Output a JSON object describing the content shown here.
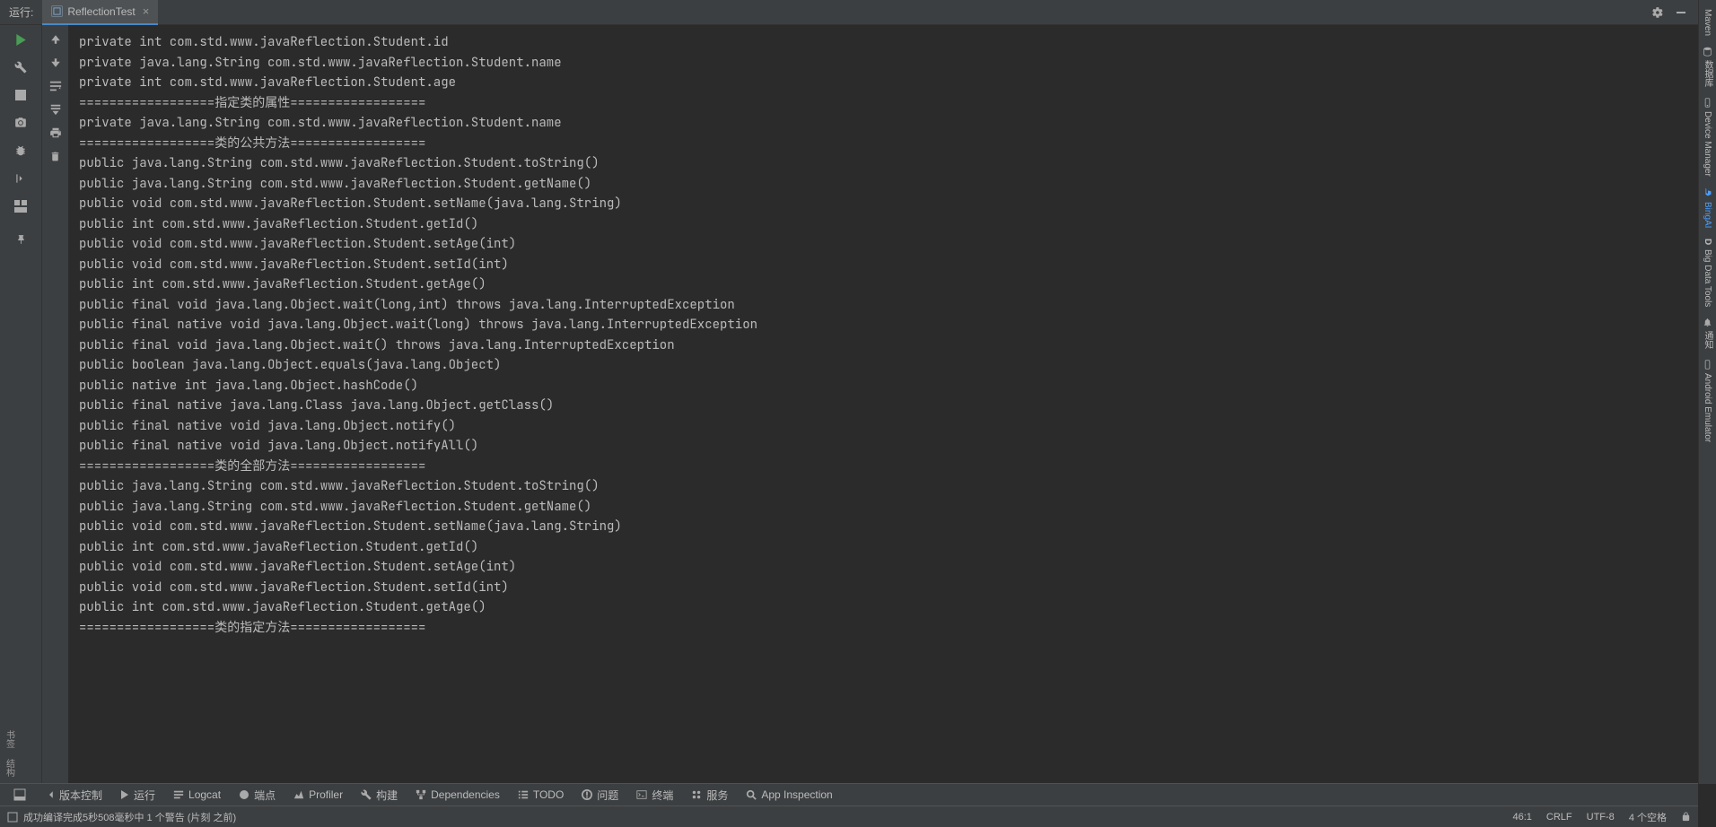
{
  "tabbar": {
    "run_label": "运行:",
    "tab_name": "ReflectionTest",
    "close_glyph": "×"
  },
  "console": {
    "lines": [
      "private int com.std.www.javaReflection.Student.id",
      "private java.lang.String com.std.www.javaReflection.Student.name",
      "private int com.std.www.javaReflection.Student.age",
      "==================指定类的属性==================",
      "private java.lang.String com.std.www.javaReflection.Student.name",
      "==================类的公共方法==================",
      "public java.lang.String com.std.www.javaReflection.Student.toString()",
      "public java.lang.String com.std.www.javaReflection.Student.getName()",
      "public void com.std.www.javaReflection.Student.setName(java.lang.String)",
      "public int com.std.www.javaReflection.Student.getId()",
      "public void com.std.www.javaReflection.Student.setAge(int)",
      "public void com.std.www.javaReflection.Student.setId(int)",
      "public int com.std.www.javaReflection.Student.getAge()",
      "public final void java.lang.Object.wait(long,int) throws java.lang.InterruptedException",
      "public final native void java.lang.Object.wait(long) throws java.lang.InterruptedException",
      "public final void java.lang.Object.wait() throws java.lang.InterruptedException",
      "public boolean java.lang.Object.equals(java.lang.Object)",
      "public native int java.lang.Object.hashCode()",
      "public final native java.lang.Class java.lang.Object.getClass()",
      "public final native void java.lang.Object.notify()",
      "public final native void java.lang.Object.notifyAll()",
      "==================类的全部方法==================",
      "public java.lang.String com.std.www.javaReflection.Student.toString()",
      "public java.lang.String com.std.www.javaReflection.Student.getName()",
      "public void com.std.www.javaReflection.Student.setName(java.lang.String)",
      "public int com.std.www.javaReflection.Student.getId()",
      "public void com.std.www.javaReflection.Student.setAge(int)",
      "public void com.std.www.javaReflection.Student.setId(int)",
      "public int com.std.www.javaReflection.Student.getAge()",
      "==================类的指定方法=================="
    ]
  },
  "bottom_tools": {
    "version_control": "版本控制",
    "run": "运行",
    "logcat": "Logcat",
    "terminal": "端点",
    "profiler": "Profiler",
    "build": "构建",
    "dependencies": "Dependencies",
    "todo": "TODO",
    "problems": "问题",
    "terminal2": "终端",
    "services": "服务",
    "app_inspection": "App Inspection"
  },
  "status": {
    "message": "成功编译完成5秒508毫秒中 1 个警告 (片刻 之前)",
    "cursor": "46:1",
    "line_sep": "CRLF",
    "encoding": "UTF-8",
    "indent": "4 个空格"
  },
  "right_tools": {
    "maven": "Maven",
    "database": "数据库",
    "device_manager": "Device Manager",
    "bing": "BingAI",
    "big_data": "Big Data Tools",
    "notif": "通知",
    "android": "Android Emulator"
  },
  "left_tools": {
    "bookmarks": "书签",
    "structure": "结构"
  }
}
